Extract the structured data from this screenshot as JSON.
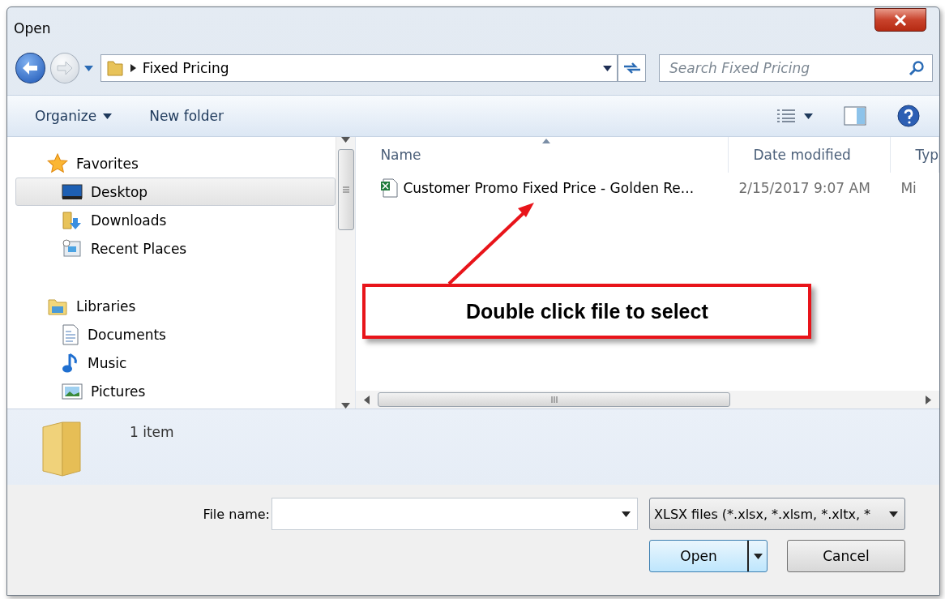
{
  "window": {
    "title": "Open"
  },
  "address": {
    "path": "Fixed Pricing"
  },
  "search": {
    "placeholder": "Search Fixed Pricing"
  },
  "toolbar": {
    "organize": "Organize",
    "new_folder": "New folder"
  },
  "nav": [
    {
      "label": "Favorites",
      "selected": false,
      "children": [
        {
          "label": "Desktop",
          "selected": true
        },
        {
          "label": "Downloads",
          "selected": false
        },
        {
          "label": "Recent Places",
          "selected": false
        }
      ]
    },
    {
      "label": "Libraries",
      "selected": false,
      "children": [
        {
          "label": "Documents",
          "selected": false
        },
        {
          "label": "Music",
          "selected": false
        },
        {
          "label": "Pictures",
          "selected": false
        }
      ]
    }
  ],
  "columns": [
    {
      "label": "Name",
      "sorted": true
    },
    {
      "label": "Date modified",
      "sorted": false
    },
    {
      "label": "Typ",
      "sorted": false
    }
  ],
  "files": [
    {
      "name": "Customer Promo Fixed Price - Golden Re...",
      "date": "2/15/2017 9:07 AM",
      "column_3": "Mi",
      "selected": false
    }
  ],
  "callout": {
    "text": "Double click file to select"
  },
  "details": {
    "count": "1 item"
  },
  "file_name": {
    "label": "File name:"
  },
  "file_type": {
    "value": "XLSX files (*.xlsx, *.xlsm, *.xltx, *"
  },
  "buttons": {
    "open": "Open",
    "cancel": "Cancel"
  }
}
